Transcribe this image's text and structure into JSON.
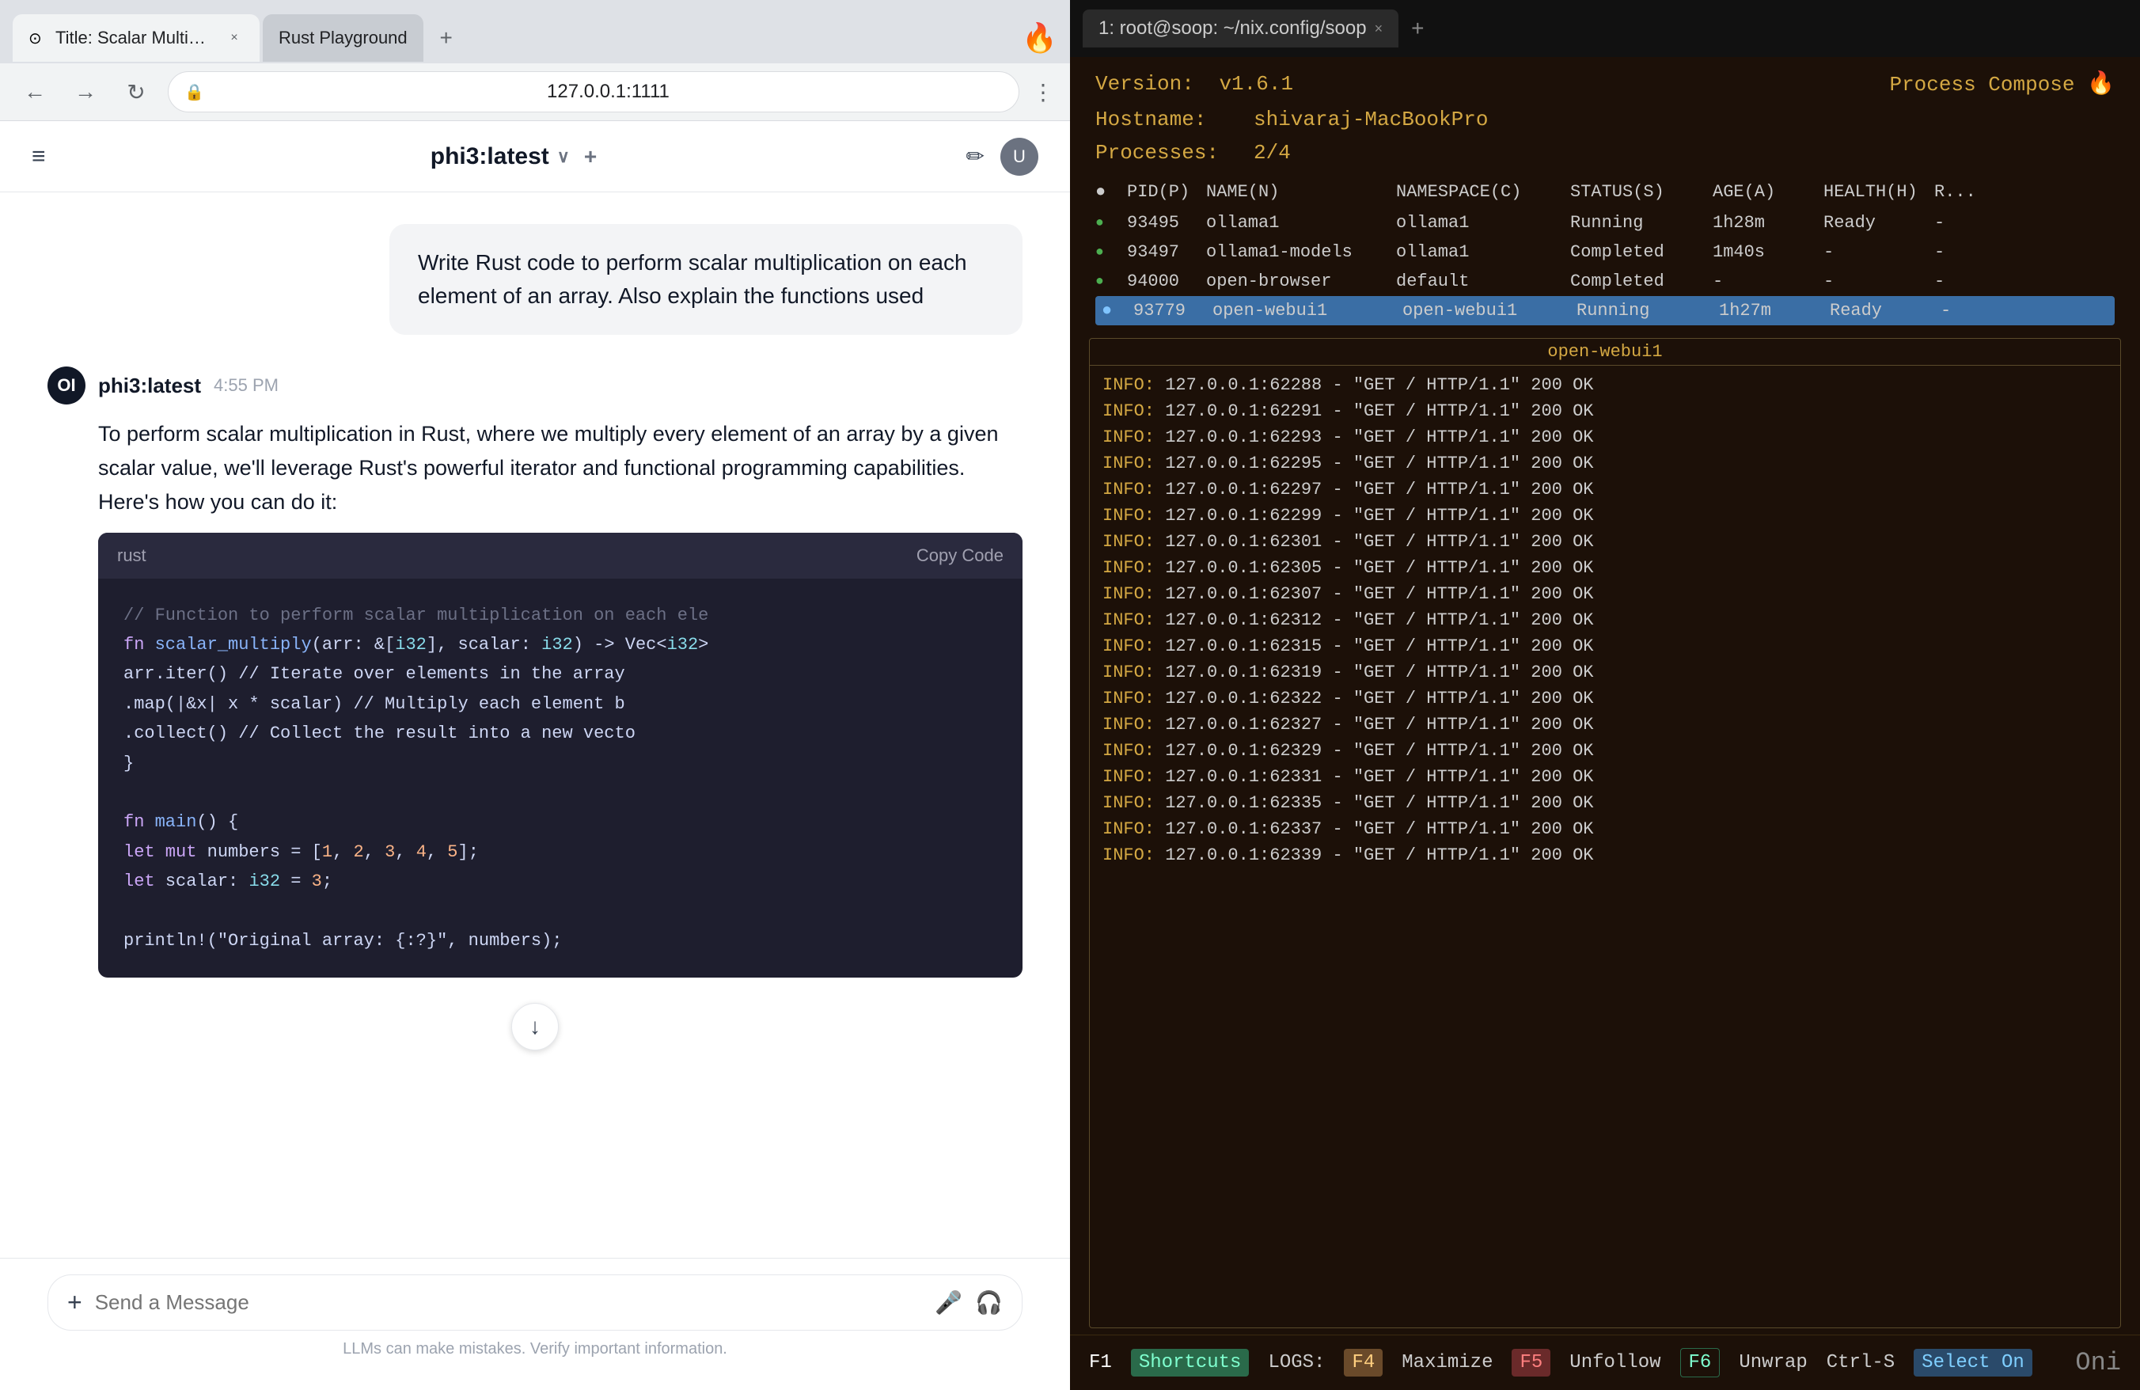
{
  "browser": {
    "tabs": [
      {
        "id": "tab1",
        "title": "Title: Scalar Multiply Arr...",
        "favicon": "⊙",
        "active": true
      },
      {
        "id": "tab2",
        "title": "Rust Playground",
        "favicon": "",
        "active": false
      }
    ],
    "new_tab_label": "+",
    "fire_icon": "🔥",
    "nav": {
      "back": "←",
      "forward": "→",
      "refresh": "↻"
    },
    "address": {
      "lock": "🔒",
      "url": "127.0.0.1:1111",
      "menu": "⋯"
    },
    "menu_dots": "⋮"
  },
  "chat": {
    "header": {
      "hamburger": "≡",
      "model_name": "phi3:latest",
      "chevron": "∨",
      "plus": "+",
      "edit_icon": "✏",
      "avatar_letter": "U"
    },
    "messages": [
      {
        "type": "user",
        "text": "Write Rust code to perform scalar multiplication on each element of an array. Also explain the functions used"
      },
      {
        "type": "assistant",
        "name": "phi3:latest",
        "time": "4:55 PM",
        "logo": "OI",
        "intro": "To perform scalar multiplication in Rust, where we multiply every element of an array by a given scalar value, we'll leverage Rust's powerful iterator and functional programming capabilities. Here's how you can do it:",
        "code_lang": "rust",
        "copy_label": "Copy Code",
        "code_lines": [
          {
            "type": "comment",
            "text": "// Function to perform scalar multiplication on each ele"
          },
          {
            "type": "mixed",
            "parts": [
              {
                "type": "keyword",
                "text": "fn "
              },
              {
                "type": "function",
                "text": "scalar_multiply"
              },
              {
                "type": "default",
                "text": "(arr: &["
              },
              {
                "type": "type",
                "text": "i32"
              },
              {
                "type": "default",
                "text": "], scalar: "
              },
              {
                "type": "type",
                "text": "i32"
              },
              {
                "type": "default",
                "text": ") -> Vec<"
              },
              {
                "type": "type",
                "text": "i32"
              },
              {
                "type": "default",
                "text": ">"
              }
            ]
          },
          {
            "type": "default",
            "text": "    arr.iter() // Iterate over elements in the array"
          },
          {
            "type": "default",
            "text": "        .map(|&x| x * scalar) // Multiply each element b"
          },
          {
            "type": "default",
            "text": "        .collect() // Collect the result into a new vecto"
          },
          {
            "type": "default",
            "text": "}"
          },
          {
            "type": "default",
            "text": ""
          },
          {
            "type": "mixed",
            "parts": [
              {
                "type": "keyword",
                "text": "fn "
              },
              {
                "type": "function",
                "text": "main"
              },
              {
                "type": "default",
                "text": "() {"
              }
            ]
          },
          {
            "type": "mixed",
            "parts": [
              {
                "type": "keyword",
                "text": "    let mut "
              },
              {
                "type": "default",
                "text": "numbers = ["
              },
              {
                "type": "number",
                "text": "1"
              },
              {
                "type": "default",
                "text": ", "
              },
              {
                "type": "number",
                "text": "2"
              },
              {
                "type": "default",
                "text": ", "
              },
              {
                "type": "number",
                "text": "3"
              },
              {
                "type": "default",
                "text": ", "
              },
              {
                "type": "number",
                "text": "4"
              },
              {
                "type": "default",
                "text": ", "
              },
              {
                "type": "number",
                "text": "5"
              },
              {
                "type": "default",
                "text": "];"
              }
            ]
          },
          {
            "type": "mixed",
            "parts": [
              {
                "type": "keyword",
                "text": "    let "
              },
              {
                "type": "default",
                "text": "scalar: "
              },
              {
                "type": "type",
                "text": "i32"
              },
              {
                "type": "default",
                "text": " = "
              },
              {
                "type": "number",
                "text": "3"
              },
              {
                "type": "default",
                "text": ";"
              }
            ]
          },
          {
            "type": "default",
            "text": ""
          },
          {
            "type": "default",
            "text": "    println!(\"Original array: {:?}\", numbers);"
          }
        ]
      }
    ],
    "scroll_down": "↓",
    "input": {
      "plus": "+",
      "placeholder": "Send a Message",
      "mic": "🎤",
      "headphone": "🎧"
    },
    "disclaimer": "LLMs can make mistakes. Verify important information."
  },
  "terminal": {
    "tab_label": "1: root@soop: ~/nix.config/soop",
    "tab_close": "×",
    "new_tab": "+",
    "process_compose": {
      "title": "Process Compose",
      "fire": "🔥",
      "version_label": "Version:",
      "version_value": "v1.6.1",
      "hostname_label": "Hostname:",
      "hostname_value": "shivaraj-MacBookPro",
      "processes_label": "Processes:",
      "processes_value": "2/4"
    },
    "table": {
      "headers": [
        "●",
        "PID(P)",
        "NAME(N)",
        "NAMESPACE(C)",
        "STATUS(S)",
        "AGE(A)",
        "HEALTH(H)",
        "R..."
      ],
      "rows": [
        {
          "bullet": "●",
          "bullet_color": "green",
          "pid": "93495",
          "name": "ollama1",
          "namespace": "ollama1",
          "status": "Running",
          "age": "1h28m",
          "health": "Ready",
          "r": "-",
          "selected": false
        },
        {
          "bullet": "●",
          "bullet_color": "green",
          "pid": "93497",
          "name": "ollama1-models",
          "namespace": "ollama1",
          "status": "Completed",
          "age": "1m40s",
          "health": "-",
          "r": "-",
          "selected": false
        },
        {
          "bullet": "●",
          "bullet_color": "green",
          "pid": "94000",
          "name": "open-browser",
          "namespace": "default",
          "status": "Completed",
          "age": "-",
          "health": "-",
          "r": "-",
          "selected": false
        },
        {
          "bullet": "●",
          "bullet_color": "blue",
          "pid": "93779",
          "name": "open-webui1",
          "namespace": "open-webui1",
          "status": "Running",
          "age": "1h27m",
          "health": "Ready",
          "r": "-",
          "selected": true
        }
      ]
    },
    "log_panel": {
      "title": "open-webui1",
      "lines": [
        "INFO:     127.0.0.1:62288 - \"GET / HTTP/1.1\" 200 OK",
        "INFO:     127.0.0.1:62291 - \"GET / HTTP/1.1\" 200 OK",
        "INFO:     127.0.0.1:62293 - \"GET / HTTP/1.1\" 200 OK",
        "INFO:     127.0.0.1:62295 - \"GET / HTTP/1.1\" 200 OK",
        "INFO:     127.0.0.1:62297 - \"GET / HTTP/1.1\" 200 OK",
        "INFO:     127.0.0.1:62299 - \"GET / HTTP/1.1\" 200 OK",
        "INFO:     127.0.0.1:62301 - \"GET / HTTP/1.1\" 200 OK",
        "INFO:     127.0.0.1:62305 - \"GET / HTTP/1.1\" 200 OK",
        "INFO:     127.0.0.1:62307 - \"GET / HTTP/1.1\" 200 OK",
        "INFO:     127.0.0.1:62312 - \"GET / HTTP/1.1\" 200 OK",
        "INFO:     127.0.0.1:62315 - \"GET / HTTP/1.1\" 200 OK",
        "INFO:     127.0.0.1:62319 - \"GET / HTTP/1.1\" 200 OK",
        "INFO:     127.0.0.1:62322 - \"GET / HTTP/1.1\" 200 OK",
        "INFO:     127.0.0.1:62327 - \"GET / HTTP/1.1\" 200 OK",
        "INFO:     127.0.0.1:62329 - \"GET / HTTP/1.1\" 200 OK",
        "INFO:     127.0.0.1:62331 - \"GET / HTTP/1.1\" 200 OK",
        "INFO:     127.0.0.1:62335 - \"GET / HTTP/1.1\" 200 OK",
        "INFO:     127.0.0.1:62337 - \"GET / HTTP/1.1\" 200 OK",
        "INFO:     127.0.0.1:62339 - \"GET / HTTP/1.1\" 200 OK"
      ]
    },
    "bottom_bar": {
      "f1": "F1",
      "shortcuts": "Shortcuts",
      "logs_label": "LOGS:",
      "f4": "F4",
      "maximize": "Maximize",
      "f5": "F5",
      "unfollow": "Unfollow",
      "f6": "F6",
      "unwrap": "Unwrap",
      "ctrl_s": "Ctrl-S",
      "select_on": "Select On",
      "oni": "Oni"
    }
  }
}
